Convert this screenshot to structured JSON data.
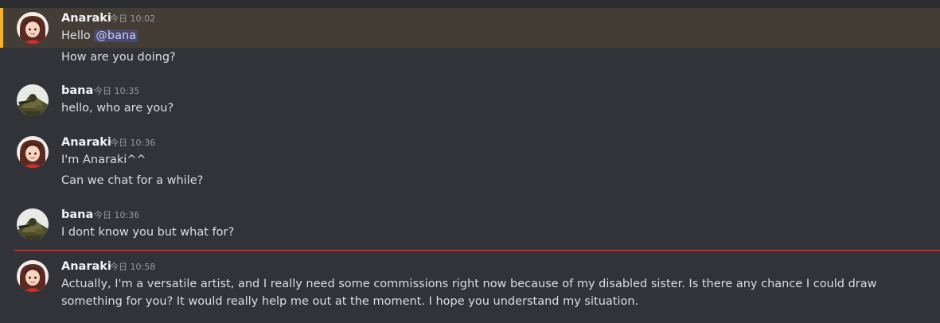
{
  "messages": [
    {
      "author": "Anaraki",
      "time": "今日 10:02",
      "greeting": "Hello ",
      "mention": "@bana",
      "line2": "How are you doing?"
    },
    {
      "author": "bana",
      "time": "今日 10:35",
      "line1": "hello, who are you?"
    },
    {
      "author": "Anaraki",
      "time": "今日 10:36",
      "line1": "I'm Anaraki^^",
      "line2": "Can we chat for a while?"
    },
    {
      "author": "bana",
      "time": "今日 10:36",
      "line1": "I dont know you but what for?"
    },
    {
      "author": "Anaraki",
      "time": "今日 10:58",
      "line1": "Actually, I'm a versatile artist, and I really need some commissions right now because of my disabled sister. Is there any chance I could draw something for you? It would really help me out at the moment. I hope you understand my situation."
    }
  ],
  "colors": {
    "background": "#313338",
    "mention_highlight": "#433d36",
    "mention_bar": "#f0b232",
    "new_messages_divider": "#f23f43",
    "username": "#f2f3f5",
    "timestamp": "#949ba4",
    "text": "#dbdee1"
  },
  "icons": {
    "anaraki_avatar": "anime-girl-red-hair-avatar",
    "bana_avatar": "soldier-in-armor-avatar"
  }
}
